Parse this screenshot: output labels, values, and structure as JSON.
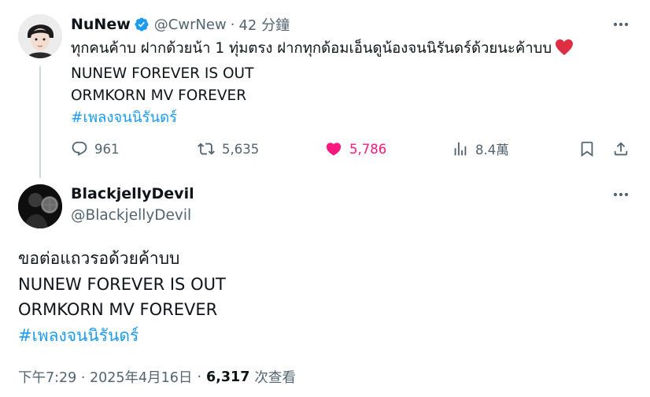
{
  "tweet1": {
    "display_name": "NuNew",
    "verified_icon": "verified-badge-icon",
    "handle": "@CwrNew",
    "separator": "·",
    "time_ago": "42 分鐘",
    "text_line1": "ทุกคนค้าบ ฝากด้วยน้า 1 ทุ่มตรง ฝากทุกด้อมเอ็นดูน้องจนนิรันดร์ด้วยนะค้าบบ",
    "text_line2": "NUNEW FOREVER IS OUT",
    "text_line3": "ORMKORN MV FOREVER",
    "hashtag": "#เพลงจนนิรันดร์",
    "stats": {
      "replies": "961",
      "retweets": "5,635",
      "likes": "5,786",
      "views": "8.4萬"
    }
  },
  "tweet2": {
    "display_name": "BlackjellyDevil",
    "handle": "@BlackjellyDevil",
    "text_line1": "ขอต่อแถวรอด้วยค้าบบ",
    "text_line2": "NUNEW FOREVER IS OUT",
    "text_line3": "ORMKORN MV FOREVER",
    "hashtag": "#เพลงจนนิรันดร์",
    "timestamp": "下午7:29 · 2025年4月16日",
    "separator": "·",
    "view_count": "6,317",
    "view_label": "次查看"
  },
  "colors": {
    "text": "#0f1419",
    "secondary": "#536471",
    "link": "#1d9bf0",
    "like": "#f91880",
    "verified": "#1d9bf0",
    "thread_line": "#cfd9de"
  },
  "icons": [
    "more-icon",
    "reply-icon",
    "retweet-icon",
    "like-icon",
    "views-icon",
    "bookmark-icon",
    "share-icon",
    "heart-emoji-icon"
  ]
}
